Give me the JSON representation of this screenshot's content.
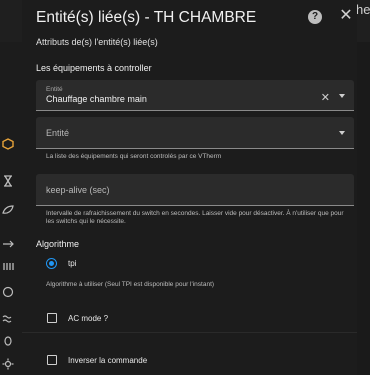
{
  "background": {
    "title_fragment": "herm"
  },
  "dialog": {
    "title": "Entité(s) liée(s) - TH CHAMBRE",
    "help_glyph": "?",
    "close_glyph": "✕",
    "subtitle": "Attributs de(s) l'entité(s) liée(s)",
    "section_devices": "Les équipements à controller",
    "device_field": {
      "float_label": "Entité",
      "value": "Chauffage chambre main",
      "clear_glyph": "✕"
    },
    "entity_field": {
      "label": "Entité"
    },
    "entity_helper": "La liste des équipements qui seront controlés par ce VTherm",
    "keepalive_field": {
      "label": "keep-alive (sec)"
    },
    "keepalive_helper": "Intervalle de rafraichissement du switch en secondes. Laisser vide pour désactiver. À n'utiliser que pour les switchs qui le nécessite.",
    "section_algorithm": "Algorithme",
    "algorithm_option": "tpi",
    "algorithm_helper": "Algorithme à utiliser (Seul TPI est disponible pour l'instant)",
    "ac_mode_label": "AC mode ?",
    "invert_label": "Inverser la commande"
  },
  "colors": {
    "accent": "#2196f3",
    "side_icon_orange": "#e8a33a"
  }
}
